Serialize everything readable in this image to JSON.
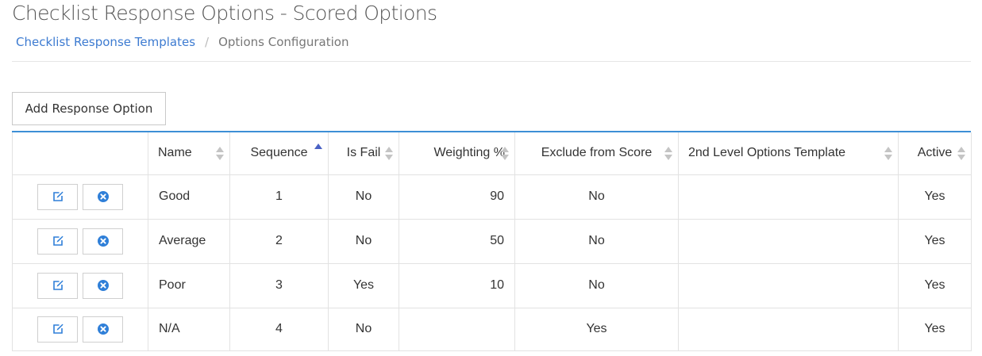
{
  "header": {
    "title": "Checklist Response Options - Scored Options",
    "breadcrumb": {
      "parent": "Checklist Response Templates",
      "separator": "/",
      "current": "Options Configuration"
    }
  },
  "toolbar": {
    "add_label": "Add Response Option"
  },
  "colors": {
    "accent": "#3d8fd6",
    "link": "#3d7bd1",
    "icon": "#2f7fd8",
    "sort_active": "#4a62c4"
  },
  "table": {
    "columns": [
      {
        "key": "actions",
        "label": ""
      },
      {
        "key": "name",
        "label": "Name",
        "sort": "none"
      },
      {
        "key": "sequence",
        "label": "Sequence",
        "sort": "asc"
      },
      {
        "key": "is_fail",
        "label": "Is Fail",
        "sort": "none"
      },
      {
        "key": "weighting",
        "label": "Weighting %",
        "sort": "none"
      },
      {
        "key": "exclude",
        "label": "Exclude from Score",
        "sort": "none"
      },
      {
        "key": "second_level",
        "label": "2nd Level Options Template",
        "sort": "none"
      },
      {
        "key": "active",
        "label": "Active",
        "sort": "none"
      }
    ],
    "row_actions": {
      "edit_icon": "edit-icon",
      "delete_icon": "delete-icon"
    },
    "rows": [
      {
        "name": "Good",
        "sequence": "1",
        "is_fail": "No",
        "weighting": "90",
        "exclude": "No",
        "second_level": "",
        "active": "Yes"
      },
      {
        "name": "Average",
        "sequence": "2",
        "is_fail": "No",
        "weighting": "50",
        "exclude": "No",
        "second_level": "",
        "active": "Yes"
      },
      {
        "name": "Poor",
        "sequence": "3",
        "is_fail": "Yes",
        "weighting": "10",
        "exclude": "No",
        "second_level": "",
        "active": "Yes"
      },
      {
        "name": "N/A",
        "sequence": "4",
        "is_fail": "No",
        "weighting": "",
        "exclude": "Yes",
        "second_level": "",
        "active": "Yes"
      }
    ]
  }
}
